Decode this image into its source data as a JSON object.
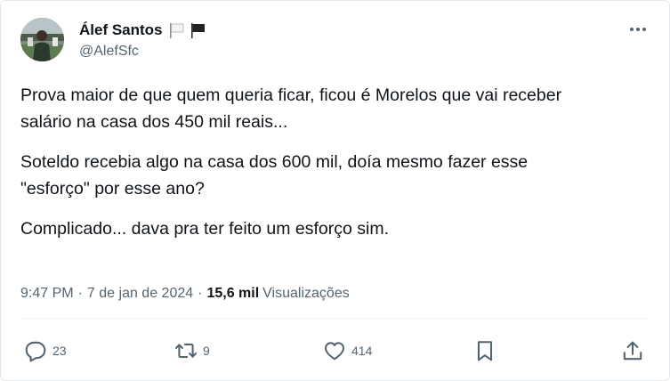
{
  "author": {
    "name": "Álef Santos",
    "handle": "@AlefSfc",
    "avatar_icon": "avatar-photo",
    "badges": [
      "white-flag-icon",
      "black-flag-icon"
    ]
  },
  "menu": {
    "icon": "more-icon"
  },
  "post": {
    "paragraphs": [
      "Prova maior de que quem queria ficar, ficou é Morelos que vai receber\nsalário na casa dos 450 mil reais...",
      "Soteldo recebia algo na casa dos 600 mil, doía mesmo fazer esse\n\"esforço\" por esse ano?",
      "Complicado... dava pra ter feito um esforço sim."
    ]
  },
  "meta": {
    "time": "9:47 PM",
    "separator": "·",
    "date": "7 de jan de 2024",
    "views_count": "15,6 mil",
    "views_label": "Visualizações"
  },
  "actions": {
    "replies": {
      "icon": "reply-icon",
      "count": "23"
    },
    "reposts": {
      "icon": "repost-icon",
      "count": "9"
    },
    "likes": {
      "icon": "like-icon",
      "count": "414"
    },
    "bookmark": {
      "icon": "bookmark-icon"
    },
    "share": {
      "icon": "share-icon"
    }
  },
  "colors": {
    "text_primary": "#0f1419",
    "text_secondary": "#536471",
    "divider": "#eff3f4"
  }
}
